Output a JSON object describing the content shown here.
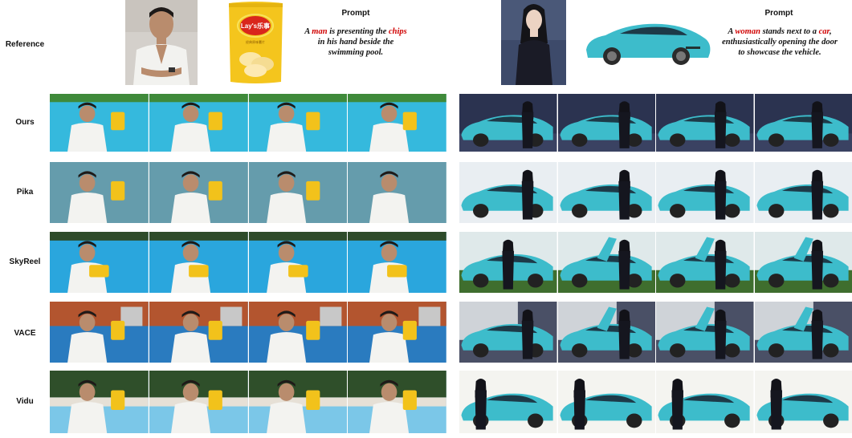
{
  "reference_label": "Reference",
  "left_prompt": {
    "title": "Prompt",
    "segments": [
      "A ",
      "man",
      " is presenting the ",
      "chips",
      " in his hand beside the swimming pool."
    ]
  },
  "right_prompt": {
    "title": "Prompt",
    "segments": [
      "A ",
      "woman",
      " stands next to a ",
      "car",
      ", enthusiastically opening the door to showcase the vehicle."
    ]
  },
  "chips_bag": {
    "brand_text": "Lay's乐事",
    "small_text": "经典原味薯片"
  },
  "colors": {
    "keyword": "#d00000",
    "pool": "#35b9dd",
    "car": "#3dbccb",
    "chips": "#f2c21b"
  },
  "rows": [
    {
      "label": "Ours"
    },
    {
      "label": "Pika"
    },
    {
      "label": "SkyReel"
    },
    {
      "label": "VACE"
    },
    {
      "label": "Vidu"
    }
  ]
}
